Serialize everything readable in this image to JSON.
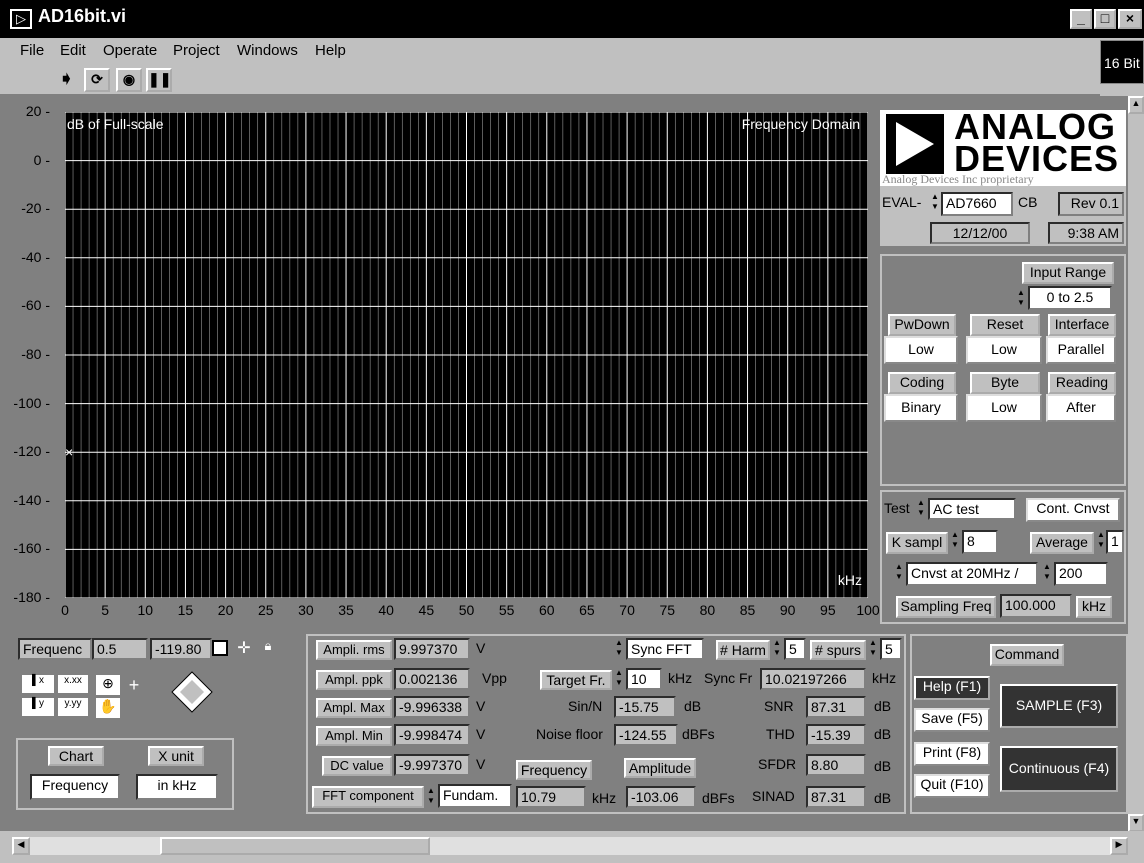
{
  "window": {
    "title": "AD16bit.vi",
    "min": "_",
    "max": "□",
    "close": "×"
  },
  "menu": [
    "File",
    "Edit",
    "Operate",
    "Project",
    "Windows",
    "Help"
  ],
  "badge": "16 Bit",
  "chart": {
    "ylabel": "dB of Full-scale",
    "title": "Frequency Domain",
    "xunit": "kHz",
    "yticks": [
      "20",
      "0",
      "-20",
      "-40",
      "-60",
      "-80",
      "-100",
      "-120",
      "-140",
      "-160",
      "-180"
    ],
    "xticks": [
      "0",
      "5",
      "10",
      "15",
      "20",
      "25",
      "30",
      "35",
      "40",
      "45",
      "50",
      "55",
      "60",
      "65",
      "70",
      "75",
      "80",
      "85",
      "90",
      "95",
      "100"
    ]
  },
  "chart_data": {
    "type": "line",
    "title": "Frequency Domain",
    "xlabel": "kHz",
    "ylabel": "dB of Full-scale",
    "xlim": [
      0,
      100
    ],
    "ylim": [
      -180,
      20
    ],
    "grid": true,
    "series": []
  },
  "cursor": {
    "label": "Frequenc",
    "x": "0.5",
    "y": "-119.80"
  },
  "chart_ctrl": {
    "chart_label": "Chart",
    "chart_value": "Frequency",
    "xunit_label": "X unit",
    "xunit_value": "in kHz"
  },
  "logo": {
    "line1": "ANALOG",
    "line2": "DEVICES",
    "proprietary": "Analog Devices Inc proprietary"
  },
  "device": {
    "eval": "EVAL-",
    "part": "AD7660",
    "suffix": "CB",
    "rev": "Rev 0.1",
    "date": "12/12/00",
    "time": "9:38 AM"
  },
  "config": {
    "input_range_label": "Input Range",
    "input_range": "0 to 2.5",
    "pwdown_label": "PwDown",
    "pwdown": "Low",
    "reset_label": "Reset",
    "reset": "Low",
    "interface_label": "Interface",
    "interface": "Parallel",
    "coding_label": "Coding",
    "coding": "Binary",
    "byte_label": "Byte",
    "byte": "Low",
    "reading_label": "Reading",
    "reading": "After"
  },
  "test": {
    "test_label": "Test",
    "test_value": "AC test",
    "cont_button": "Cont. Cnvst",
    "ksampl_label": "K sampl",
    "ksampl": "8",
    "average_label": "Average",
    "average": "1",
    "cnvst": "Cnvst at 20MHz /",
    "cnvst_div": "200",
    "samp_label": "Sampling Freq",
    "samp_value": "100.000",
    "samp_unit": "kHz"
  },
  "measure": {
    "ampl_rms_label": "Ampli. rms",
    "ampl_rms": "9.997370",
    "ampl_rms_unit": "V",
    "ampl_ppk_label": "Ampl. ppk",
    "ampl_ppk": "0.002136",
    "ampl_ppk_unit": "Vpp",
    "ampl_max_label": "Ampl. Max",
    "ampl_max": "-9.996338",
    "ampl_max_unit": "V",
    "ampl_min_label": "Ampl. Min",
    "ampl_min": "-9.998474",
    "ampl_min_unit": "V",
    "dc_label": "DC value",
    "dc": "-9.997370",
    "dc_unit": "V",
    "fft_label": "FFT component",
    "fft_value": "Fundam.",
    "sync_fft": "Sync FFT",
    "harm_label": "# Harm",
    "harm": "5",
    "spurs_label": "# spurs",
    "spurs": "5",
    "target_label": "Target Fr.",
    "target": "10",
    "target_unit": "kHz",
    "syncfr_label": "Sync Fr",
    "syncfr": "10.02197266",
    "syncfr_unit": "kHz",
    "sinn_label": "Sin/N",
    "sinn": "-15.75",
    "sinn_unit": "dB",
    "noise_label": "Noise floor",
    "noise": "-124.55",
    "noise_unit": "dBFs",
    "snr_label": "SNR",
    "snr": "87.31",
    "snr_unit": "dB",
    "thd_label": "THD",
    "thd": "-15.39",
    "thd_unit": "dB",
    "sfdr_label": "SFDR",
    "sfdr": "8.80",
    "sfdr_unit": "dB",
    "sinad_label": "SINAD",
    "sinad": "87.31",
    "sinad_unit": "dB",
    "freq_label": "Frequency",
    "freq": "10.79",
    "freq_unit": "kHz",
    "amp_label": "Amplitude",
    "amp": "-103.06",
    "amp_unit": "dBFs"
  },
  "command": {
    "label": "Command",
    "help": "Help (F1)",
    "save": "Save (F5)",
    "print": "Print (F8)",
    "quit": "Quit (F10)",
    "sample": "SAMPLE (F3)",
    "continuous": "Continuous (F4)"
  }
}
